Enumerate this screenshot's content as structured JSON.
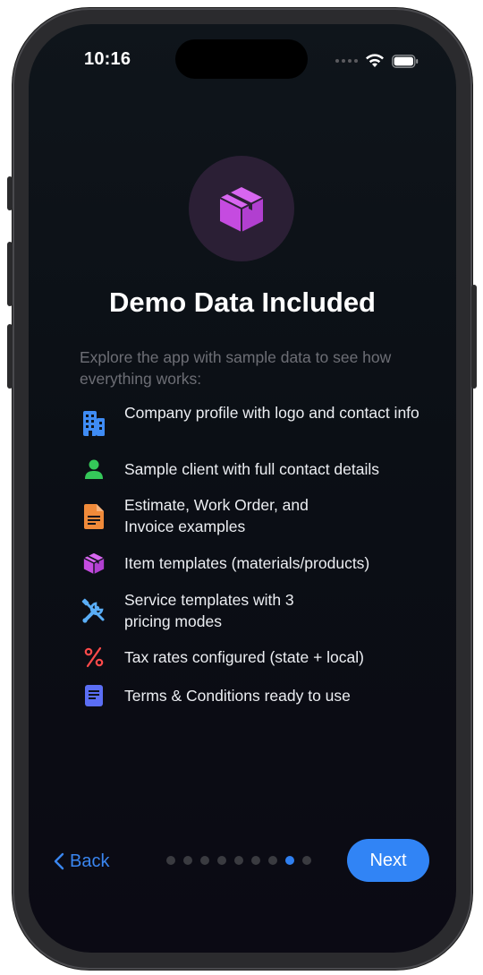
{
  "status_bar": {
    "time": "10:16"
  },
  "onboarding": {
    "title": "Demo Data Included",
    "subtitle": "Explore the app with sample data to see how everything works:",
    "hero_icon": "cube-icon",
    "features": [
      {
        "icon": "building-icon",
        "color": "#3f8cf4",
        "text": "Company profile with logo and contact info"
      },
      {
        "icon": "person-icon",
        "color": "#35c759",
        "text": "Sample client with full contact details"
      },
      {
        "icon": "document-icon",
        "color": "#f08a3a",
        "text": "Estimate, Work Order, and Invoice examples"
      },
      {
        "icon": "cube-icon",
        "color": "#c54be0",
        "text": "Item templates (materials/products)"
      },
      {
        "icon": "tools-icon",
        "color": "#5aaef7",
        "text": "Service templates with 3 pricing modes"
      },
      {
        "icon": "percent-icon",
        "color": "#ff4a4a",
        "text": "Tax rates configured (state + local)"
      },
      {
        "icon": "note-icon",
        "color": "#5b6ef5",
        "text": "Terms & Conditions ready to use"
      }
    ]
  },
  "footer": {
    "back_label": "Back",
    "next_label": "Next",
    "page_count": 9,
    "current_page": 8
  },
  "colors": {
    "accent": "#3184f5",
    "hero_bg": "#2b1f35",
    "cube": "#c54be0"
  }
}
